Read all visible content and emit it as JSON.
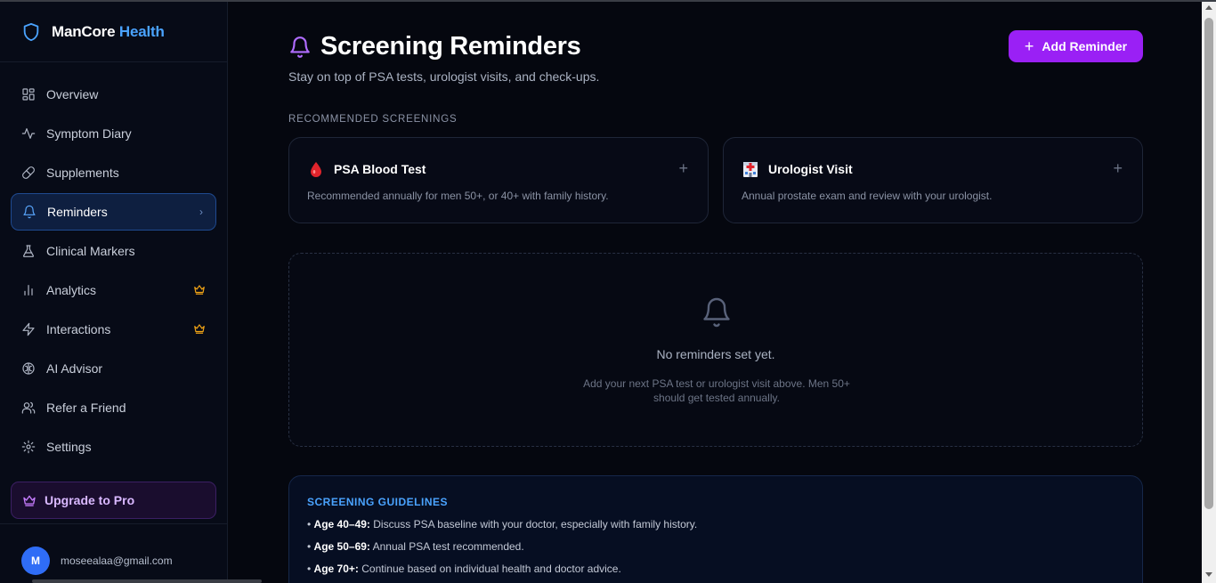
{
  "brand": {
    "name_part1": "ManCore",
    "name_part2": "Health"
  },
  "sidebar": {
    "items": [
      {
        "label": "Overview",
        "icon": "grid-icon"
      },
      {
        "label": "Symptom Diary",
        "icon": "activity-icon"
      },
      {
        "label": "Supplements",
        "icon": "pill-icon"
      },
      {
        "label": "Reminders",
        "icon": "bell-icon",
        "active": true
      },
      {
        "label": "Clinical Markers",
        "icon": "flask-icon"
      },
      {
        "label": "Analytics",
        "icon": "bar-chart-icon",
        "pro": true
      },
      {
        "label": "Interactions",
        "icon": "zap-icon",
        "pro": true
      },
      {
        "label": "AI Advisor",
        "icon": "brain-icon"
      },
      {
        "label": "Refer a Friend",
        "icon": "users-icon"
      },
      {
        "label": "Settings",
        "icon": "gear-icon"
      }
    ],
    "upgrade_label": "Upgrade to Pro",
    "user": {
      "initial": "M",
      "email": "moseealaa@gmail.com"
    }
  },
  "header": {
    "title": "Screening Reminders",
    "subtitle": "Stay on top of PSA tests, urologist visits, and check-ups.",
    "add_button": "Add Reminder"
  },
  "recommended": {
    "label": "RECOMMENDED SCREENINGS",
    "cards": [
      {
        "title": "PSA Blood Test",
        "description": "Recommended annually for men 50+, or 40+ with family history.",
        "icon": "blood-drop-icon"
      },
      {
        "title": "Urologist Visit",
        "description": "Annual prostate exam and review with your urologist.",
        "icon": "hospital-icon"
      }
    ]
  },
  "empty_state": {
    "title": "No reminders set yet.",
    "description": "Add your next PSA test or urologist visit above. Men 50+ should get tested annually."
  },
  "guidelines": {
    "title": "SCREENING GUIDELINES",
    "items": [
      {
        "age": "Age 40–49:",
        "text": "Discuss PSA baseline with your doctor, especially with family history."
      },
      {
        "age": "Age 50–69:",
        "text": "Annual PSA test recommended."
      },
      {
        "age": "Age 70+:",
        "text": "Continue based on individual health and doctor advice."
      }
    ]
  },
  "colors": {
    "accent": "#9a20f5",
    "brand_blue": "#4aa3ff",
    "active_bg": "#0e1f40",
    "crown": "#f2a516"
  }
}
